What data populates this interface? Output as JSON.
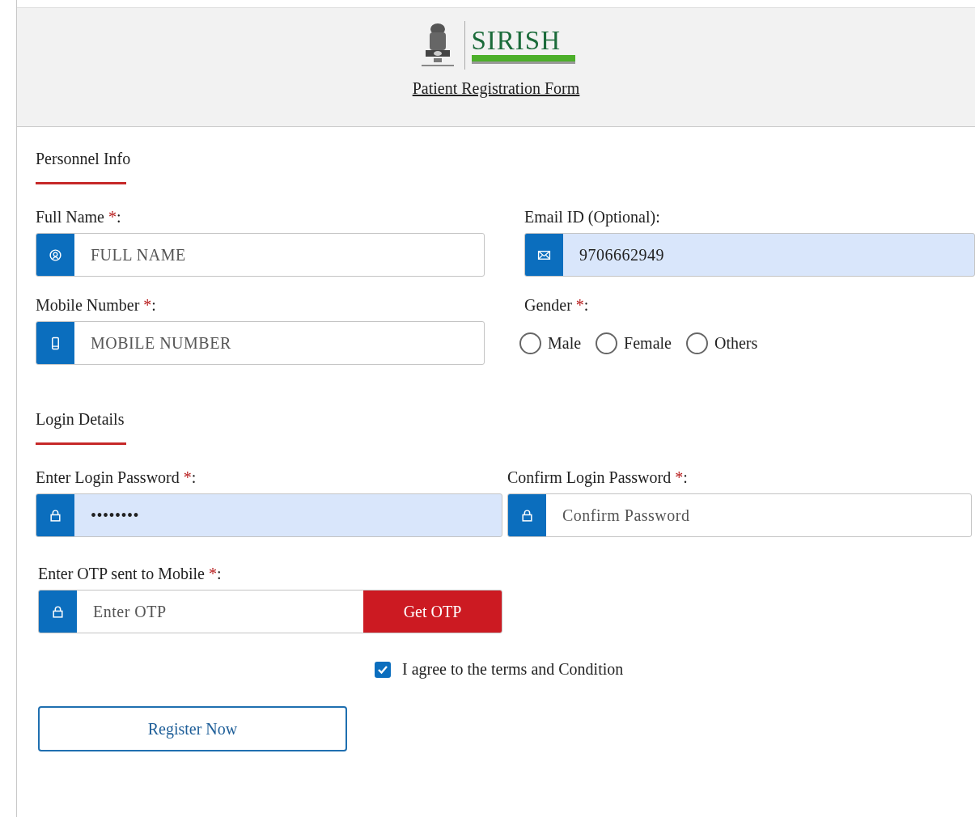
{
  "header": {
    "logo_text": "SIRISH",
    "title": "Patient Registration Form"
  },
  "personal": {
    "title": "Personnel Info",
    "fields": [
      {
        "kind": "name",
        "label": "Full Name ",
        "mark": "*",
        "end": ":",
        "placeholder": "FULL NAME",
        "autofilled": false
      },
      {
        "kind": "email",
        "label": "Email ID (Optional):",
        "value": "9706662949",
        "autofilled": true
      },
      {
        "kind": "phone",
        "label": "Mobile Number ",
        "mark": "*",
        "end": ":",
        "placeholder": "MOBILE NUMBER",
        "autofilled": false
      }
    ],
    "gender": {
      "label": "Gender ",
      "mark": "*",
      "end": ":",
      "options": [
        {
          "label": "Male",
          "selected": false
        },
        {
          "label": "Female",
          "selected": false
        },
        {
          "label": "Others",
          "selected": false
        }
      ]
    }
  },
  "login": {
    "title": "Login Details",
    "fields": [
      {
        "kind": "password",
        "label": "Enter Login Password ",
        "mark": "*",
        "end": ":",
        "value": "••••••••",
        "autofilled": true
      },
      {
        "kind": "password",
        "label": "Confirm Login Password ",
        "mark": "*",
        "end": ":",
        "placeholder": "Confirm Password",
        "autofilled": false
      }
    ],
    "otp": {
      "label": "Enter OTP sent to Mobile ",
      "mark": "*",
      "end": ":",
      "placeholder": "Enter OTP",
      "button": "Get OTP"
    }
  },
  "terms": {
    "checked": true,
    "label": "I agree to the terms and Condition"
  },
  "register_button": "Register Now"
}
